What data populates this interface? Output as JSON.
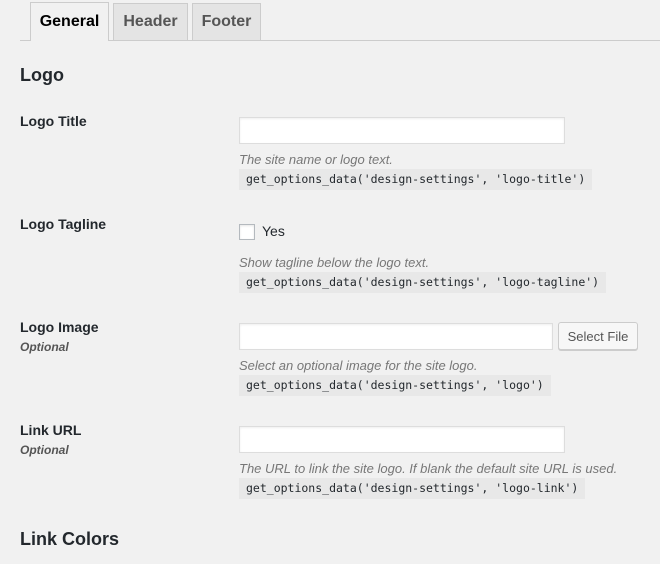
{
  "tabs": [
    {
      "label": "General",
      "active": true
    },
    {
      "label": "Header",
      "active": false
    },
    {
      "label": "Footer",
      "active": false
    }
  ],
  "sections": {
    "logo_title": "Logo",
    "link_colors_title": "Link Colors"
  },
  "fields": {
    "logo_title": {
      "label": "Logo Title",
      "value": "",
      "description": "The site name or logo text.",
      "code": "get_options_data('design-settings', 'logo-title')"
    },
    "logo_tagline": {
      "label": "Logo Tagline",
      "checkbox_label": "Yes",
      "checked": false,
      "description": "Show tagline below the logo text.",
      "code": "get_options_data('design-settings', 'logo-tagline')"
    },
    "logo_image": {
      "label": "Logo Image",
      "sublabel": "Optional",
      "value": "",
      "button_label": "Select File",
      "description": "Select an optional image for the site logo.",
      "code": "get_options_data('design-settings', 'logo')"
    },
    "link_url": {
      "label": "Link URL",
      "sublabel": "Optional",
      "value": "",
      "description": "The URL to link the site logo. If blank the default site URL is used.",
      "code": "get_options_data('design-settings', 'logo-link')"
    }
  },
  "colors": {
    "background": "#f1f1f1",
    "tab_inactive": "#e4e4e4",
    "code_background": "#e8e8e8",
    "description_text": "#777777"
  }
}
